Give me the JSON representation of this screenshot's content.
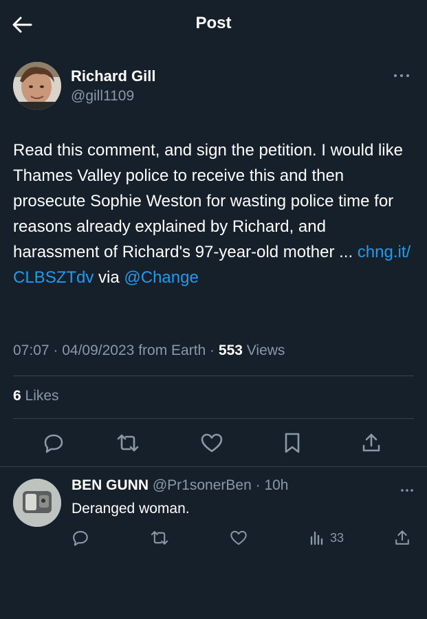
{
  "header": {
    "title": "Post"
  },
  "author": {
    "name": "Richard Gill",
    "handle": "@gill1109"
  },
  "tweet": {
    "text_1": "Read this comment, and sign the petition. I would like Thames Valley police to receive this and then prosecute Sophie Weston for wasting police time for reasons already explained by Richard, and harassment of Richard's 97-year-old mother ... ",
    "link_1": "chng.it/ CLBSZTdv",
    "text_2": " via ",
    "link_2": "@Change"
  },
  "meta": {
    "time": "07:07",
    "date": "04/09/2023",
    "source": "from Earth",
    "views_count": "553",
    "views_label": "Views"
  },
  "likes": {
    "count": "6",
    "label": "Likes"
  },
  "reply": {
    "name": "BEN GUNN",
    "handle": "@Pr1sonerBen",
    "time": "10h",
    "text": "Deranged woman.",
    "views": "33"
  },
  "icons": {
    "back": "arrow-left-icon",
    "more": "more-horizontal-icon",
    "reply": "comment-icon",
    "retweet": "retweet-icon",
    "like": "heart-icon",
    "bookmark": "bookmark-icon",
    "share": "share-icon",
    "views": "bar-chart-icon"
  },
  "colors": {
    "background": "#15202b",
    "link": "#1d9bf0",
    "secondary": "#8b98a5",
    "divider": "#38444d"
  }
}
